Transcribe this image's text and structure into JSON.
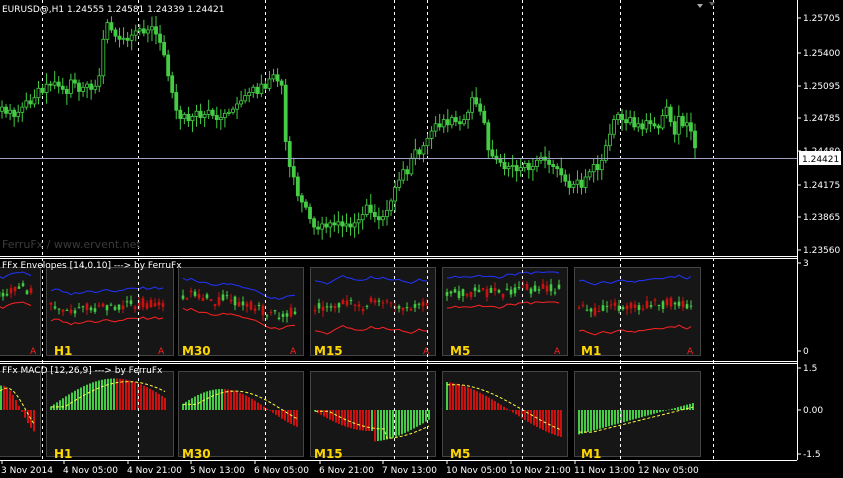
{
  "symbol_header": "EURUSD@,H1  1.24555 1.24581 1.24339 1.24421",
  "watermark": "FerruFx / www.ervent.net",
  "current_price": "1.24421",
  "colors": {
    "background": "#000000",
    "axis": "#ffffff",
    "grid_dashed": "#ffffff",
    "bull_candle": "#44cc44",
    "bear_candle": "#cc1111",
    "envelope_upper": "#2233ff",
    "envelope_lower": "#ff2222",
    "timeframe_label": "#ffd700",
    "panel_bg": "#161616",
    "price_line": "#a0a0c0"
  },
  "price_axis_labels": [
    "1.25705",
    "1.25400",
    "1.25095",
    "1.24785",
    "1.24480",
    "1.24175",
    "1.23865",
    "1.23560"
  ],
  "envelopes_indicator": {
    "title": "FFx Envelopes [14,0.10] --->  by FerruFx",
    "scale_labels": [
      "3",
      "0"
    ],
    "timeframes": [
      "H1",
      "M30",
      "M15",
      "M5",
      "M1"
    ],
    "alert_glyph": "A"
  },
  "macd_indicator": {
    "title": "FFx MACD [12,26,9] --->  by FerruFx",
    "scale_labels": [
      "1.5",
      "0.00",
      "-1.5"
    ],
    "timeframes": [
      "H1",
      "M30",
      "M15",
      "M5",
      "M1"
    ]
  },
  "time_axis_labels": [
    "3 Nov 2014",
    "4 Nov 05:00",
    "4 Nov 21:00",
    "5 Nov 13:00",
    "6 Nov 05:00",
    "6 Nov 21:00",
    "7 Nov 13:00",
    "10 Nov 05:00",
    "10 Nov 21:00",
    "11 Nov 13:00",
    "12 Nov 05:00"
  ],
  "chart_data": {
    "type": "candlestick",
    "y_range": [
      1.2351,
      1.2583
    ],
    "series_close": [
      1.2488,
      1.2482,
      1.2485,
      1.2479,
      1.2483,
      1.2488,
      1.2494,
      1.2491,
      1.2497,
      1.2506,
      1.2502,
      1.251,
      1.2509,
      1.2512,
      1.2508,
      1.2505,
      1.2501,
      1.2514,
      1.2511,
      1.2503,
      1.2507,
      1.251,
      1.2505,
      1.2508,
      1.2518,
      1.2553,
      1.2569,
      1.2562,
      1.2556,
      1.2553,
      1.2554,
      1.2552,
      1.2557,
      1.2561,
      1.2563,
      1.2559,
      1.2562,
      1.2565,
      1.2558,
      1.255,
      1.2538,
      1.2518,
      1.2502,
      1.2485,
      1.2477,
      1.2481,
      1.2475,
      1.2479,
      1.2484,
      1.2478,
      1.2481,
      1.2485,
      1.248,
      1.2476,
      1.2478,
      1.2482,
      1.2483,
      1.2486,
      1.2491,
      1.2494,
      1.2499,
      1.2502,
      1.2507,
      1.2501,
      1.251,
      1.2506,
      1.2515,
      1.2519,
      1.2513,
      1.2509,
      1.2455,
      1.2431,
      1.2421,
      1.2403,
      1.2397,
      1.2392,
      1.2381,
      1.2373,
      1.2371,
      1.2376,
      1.2373,
      1.2377,
      1.2375,
      1.2378,
      1.2374,
      1.2376,
      1.2373,
      1.2377,
      1.238,
      1.2385,
      1.2394,
      1.2387,
      1.2383,
      1.238,
      1.2383,
      1.2389,
      1.2398,
      1.2411,
      1.2418,
      1.2428,
      1.2424,
      1.2439,
      1.2447,
      1.2443,
      1.2451,
      1.2458,
      1.2465,
      1.2472,
      1.2469,
      1.2476,
      1.2471,
      1.2478,
      1.2474,
      1.2472,
      1.2476,
      1.2483,
      1.2497,
      1.2491,
      1.2484,
      1.2473,
      1.2447,
      1.2441,
      1.2438,
      1.2435,
      1.2429,
      1.2431,
      1.2432,
      1.2427,
      1.243,
      1.2434,
      1.2428,
      1.2431,
      1.2437,
      1.244,
      1.2437,
      1.2433,
      1.2431,
      1.2429,
      1.2423,
      1.2417,
      1.2411,
      1.2414,
      1.2418,
      1.2411,
      1.2421,
      1.2426,
      1.2433,
      1.2428,
      1.2437,
      1.2451,
      1.2462,
      1.2476,
      1.2481,
      1.2476,
      1.2473,
      1.2478,
      1.2469,
      1.2472,
      1.2467,
      1.2475,
      1.2472,
      1.247,
      1.2468,
      1.248,
      1.2488,
      1.2474,
      1.2462,
      1.2479,
      1.247,
      1.2473,
      1.2465,
      1.2449
    ],
    "current_price": 1.24421
  }
}
